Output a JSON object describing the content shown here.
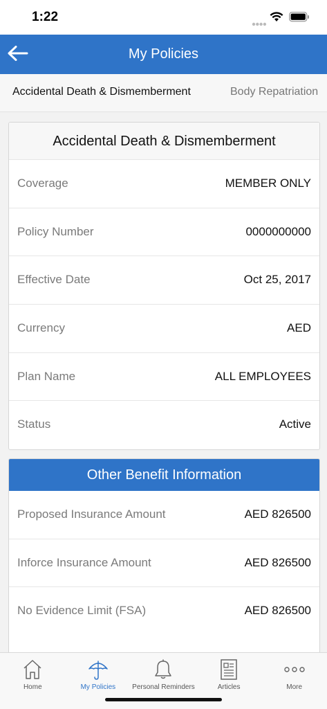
{
  "status_bar": {
    "time": "1:22"
  },
  "header": {
    "title": "My Policies"
  },
  "tabs": [
    {
      "label": "Accidental Death & Dismemberment",
      "active": true
    },
    {
      "label": "Body Repatriation",
      "active": false
    }
  ],
  "policy_card": {
    "title": "Accidental Death & Dismemberment",
    "rows": [
      {
        "label": "Coverage",
        "value": "MEMBER ONLY"
      },
      {
        "label": "Policy Number",
        "value": "0000000000"
      },
      {
        "label": "Effective Date",
        "value": "Oct 25, 2017"
      },
      {
        "label": "Currency",
        "value": "AED"
      },
      {
        "label": "Plan Name",
        "value": "ALL EMPLOYEES"
      },
      {
        "label": "Status",
        "value": "Active"
      }
    ]
  },
  "benefit_card": {
    "title": "Other Benefit Information",
    "rows": [
      {
        "label": "Proposed Insurance Amount",
        "value": "AED 826500"
      },
      {
        "label": "Inforce Insurance Amount",
        "value": "AED 826500"
      },
      {
        "label": "No Evidence Limit (FSA)",
        "value": "AED 826500"
      }
    ]
  },
  "tabbar": {
    "items": [
      {
        "label": "Home",
        "icon": "home-icon",
        "active": false
      },
      {
        "label": "My Policies",
        "icon": "umbrella-icon",
        "active": true
      },
      {
        "label": "Personal Reminders",
        "icon": "bell-icon",
        "active": false
      },
      {
        "label": "Articles",
        "icon": "article-icon",
        "active": false
      },
      {
        "label": "More",
        "icon": "more-icon",
        "active": false
      }
    ]
  },
  "colors": {
    "brand_blue": "#2f74c8",
    "label_gray": "#7a7a7a"
  }
}
